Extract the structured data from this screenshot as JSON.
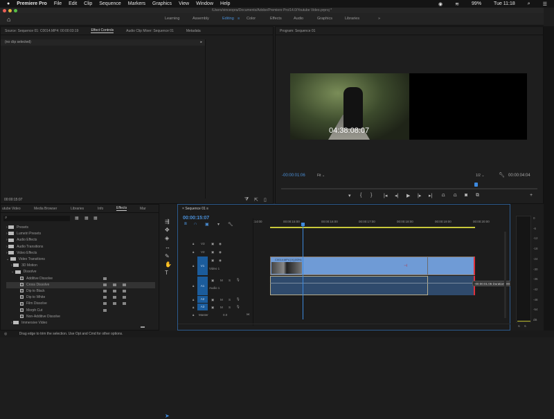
{
  "menubar": {
    "apple": "",
    "app": "Premiere Pro",
    "items": [
      "File",
      "Edit",
      "Clip",
      "Sequence",
      "Markers",
      "Graphics",
      "View",
      "Window",
      "Help"
    ],
    "battery": "99%",
    "clock": "Tue 11:18"
  },
  "window_title": "/Users/vinceopra/Documents/Adobe/Premiere Pro/14.0/Youtube Video.prproj *",
  "workspaces": [
    "Learning",
    "Assembly",
    "Editing",
    "Color",
    "Effects",
    "Audio",
    "Graphics",
    "Libraries"
  ],
  "workspaces_more": "»",
  "active_workspace": "Editing",
  "source_panel": {
    "tabs": [
      "Source: Sequence 01: C0014.MP4: 00:00:03:19",
      "Effect Controls",
      "Audio Clip Mixer: Sequence 01",
      "Metadata"
    ],
    "active": "Effect Controls",
    "clip_status": "(no clip selected)",
    "timecode": "00:00:15:07"
  },
  "program": {
    "title": "Program: Sequence 01",
    "overlay_timecode": "04:38:08:07",
    "current_timecode": "-00:00:01:06",
    "zoom": "Fit",
    "resolution": "1/2",
    "duration": "00:00:04:04",
    "playhead_fraction": 0.77
  },
  "effects_panel": {
    "tabs": [
      "utube Video",
      "Media Browser",
      "Libraries",
      "Info",
      "Effects",
      "Mar"
    ],
    "active": "Effects",
    "search_placeholder": "",
    "tree": [
      {
        "label": "Presets",
        "level": 0,
        "type": "folder"
      },
      {
        "label": "Lumetri Presets",
        "level": 0,
        "type": "folder"
      },
      {
        "label": "Audio Effects",
        "level": 0,
        "type": "folder"
      },
      {
        "label": "Audio Transitions",
        "level": 0,
        "type": "folder"
      },
      {
        "label": "Video Effects",
        "level": 0,
        "type": "folder"
      },
      {
        "label": "Video Transitions",
        "level": 0,
        "type": "folder"
      },
      {
        "label": "3D Motion",
        "level": 1,
        "type": "folder"
      },
      {
        "label": "Dissolve",
        "level": 1,
        "type": "folder"
      },
      {
        "label": "Additive Dissolve",
        "level": 2,
        "type": "fx",
        "badges": 1
      },
      {
        "label": "Cross Dissolve",
        "level": 2,
        "type": "fx",
        "badges": 3,
        "selected": true
      },
      {
        "label": "Dip to Black",
        "level": 2,
        "type": "fx",
        "badges": 3
      },
      {
        "label": "Dip to White",
        "level": 2,
        "type": "fx",
        "badges": 3
      },
      {
        "label": "Film Dissolve",
        "level": 2,
        "type": "fx",
        "badges": 3
      },
      {
        "label": "Morph Cut",
        "level": 2,
        "type": "fx",
        "badges": 1
      },
      {
        "label": "Non-Additive Dissolve",
        "level": 2,
        "type": "fx",
        "badges": 0
      },
      {
        "label": "Immersive Video",
        "level": 1,
        "type": "folder"
      }
    ]
  },
  "timeline": {
    "title": "Sequence 01",
    "timecode": "00:00:15:07",
    "ruler": [
      ":14:00",
      "00:00:15:00",
      "00:00:16:00",
      "00:00:17:00",
      "00:00:18:00",
      "00:00:19:00",
      "00:00:20:00"
    ],
    "tracks": {
      "v3": "V3",
      "v2": "V2",
      "v1": "V1",
      "v1_name": "Video 1",
      "a1": "A1",
      "a1_name": "Audio 1",
      "a2": "A2",
      "a3": "A3",
      "master": "Master",
      "master_val": "0.0",
      "m": "M",
      "s": "S"
    },
    "clip_label": "C0014.MP4 [V] [83%]",
    "tooltip": "-00:00:01:06 Duration: 00:00:04:04"
  },
  "meter": {
    "scale": [
      "0",
      "-6",
      "-12",
      "-18",
      "-24",
      "-30",
      "-36",
      "-42",
      "-48",
      "-54",
      "dB"
    ],
    "solo": [
      "S",
      "S"
    ]
  },
  "status": "Drag edge to trim the selection. Use Opt and Cmd for other options.",
  "colors": {
    "accent": "#4a90d9",
    "clip_video": "#6f9bd6",
    "clip_audio": "#2f4a6c",
    "work_area": "#c9c93a"
  }
}
